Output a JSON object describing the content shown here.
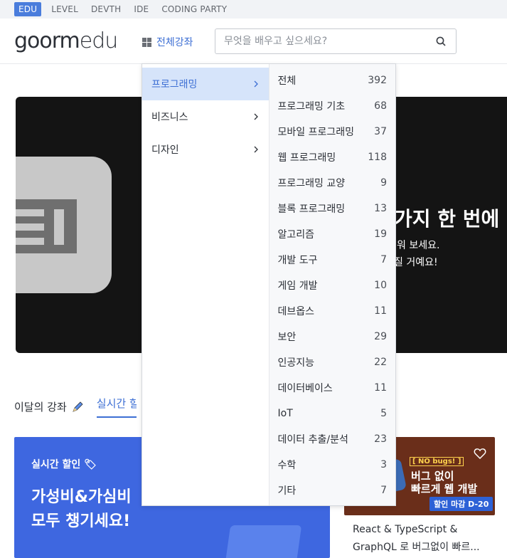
{
  "topnav": {
    "tabs": [
      "EDU",
      "LEVEL",
      "DEVTH",
      "IDE",
      "CODING PARTY"
    ]
  },
  "header": {
    "logo": "goorm",
    "logo_suffix": "edu",
    "all_courses": "전체강좌",
    "search_placeholder": "무엇을 배우고 싶으세요?"
  },
  "banner": {
    "title": "가지 한 번에 -",
    "sub1": "워 보세요.",
    "sub2": "질 거예요!"
  },
  "section": {
    "tab_month": "이달의 강좌",
    "tab_realtime": "실시간 할인"
  },
  "card_blue": {
    "sale": "실시간 할인",
    "headline1": "가성비&가심비",
    "headline2": "모두 챙기세요!"
  },
  "card_right": {
    "badge": "[ NO bugs! ]",
    "thumb1": "버그 없이",
    "thumb2": "빠르게 웹 개발",
    "dday": "할인 마감 D-20",
    "title1": "React & TypeScript &",
    "title2": "GraphQL 로 버그없이 빠르..."
  },
  "dropdown": {
    "categories": [
      {
        "label": "프로그래밍",
        "active": true
      },
      {
        "label": "비즈니스",
        "active": false
      },
      {
        "label": "디자인",
        "active": false
      }
    ],
    "subcategories": [
      {
        "label": "전체",
        "count": "392"
      },
      {
        "label": "프로그래밍 기초",
        "count": "68"
      },
      {
        "label": "모바일 프로그래밍",
        "count": "37"
      },
      {
        "label": "웹 프로그래밍",
        "count": "118"
      },
      {
        "label": "프로그래밍 교양",
        "count": "9"
      },
      {
        "label": "블록 프로그래밍",
        "count": "13"
      },
      {
        "label": "알고리즘",
        "count": "19"
      },
      {
        "label": "개발 도구",
        "count": "7"
      },
      {
        "label": "게임 개발",
        "count": "10"
      },
      {
        "label": "데브옵스",
        "count": "11"
      },
      {
        "label": "보안",
        "count": "29"
      },
      {
        "label": "인공지능",
        "count": "22"
      },
      {
        "label": "데이터베이스",
        "count": "11"
      },
      {
        "label": "IoT",
        "count": "5"
      },
      {
        "label": "데이터 추출/분석",
        "count": "23"
      },
      {
        "label": "수학",
        "count": "3"
      },
      {
        "label": "기타",
        "count": "7"
      }
    ]
  }
}
